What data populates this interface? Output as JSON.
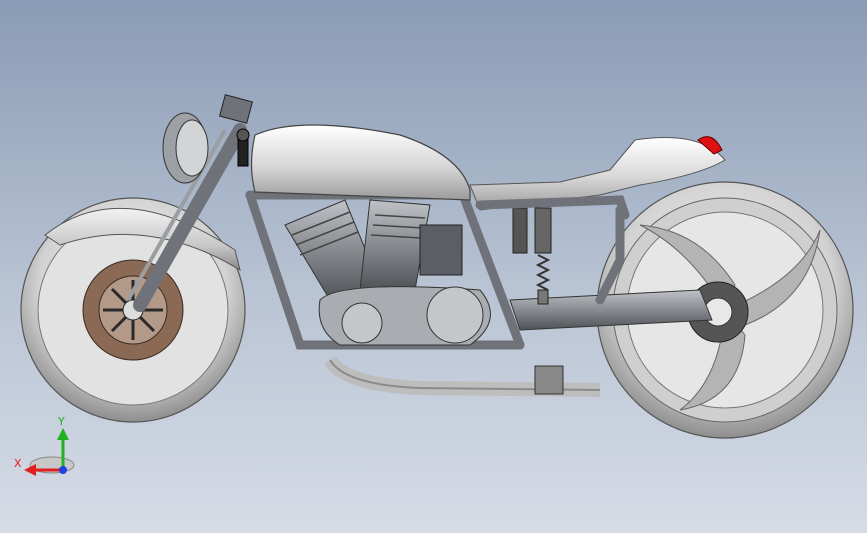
{
  "viewport": {
    "background_top": "#8a9bb5",
    "background_bottom": "#d6dce6",
    "model_name": "cafe-racer-motorcycle"
  },
  "triad": {
    "x_label": "X",
    "y_label": "Y",
    "x_color": "#e02020",
    "y_color": "#20b020",
    "z_color": "#2040e0"
  },
  "colors": {
    "tire": "#d9d9d9",
    "tire_shadow": "#8c8c8c",
    "frame": "#6f7379",
    "engine": "#9a9da2",
    "disc": "#8a6a55",
    "taillight": "#e01010"
  }
}
